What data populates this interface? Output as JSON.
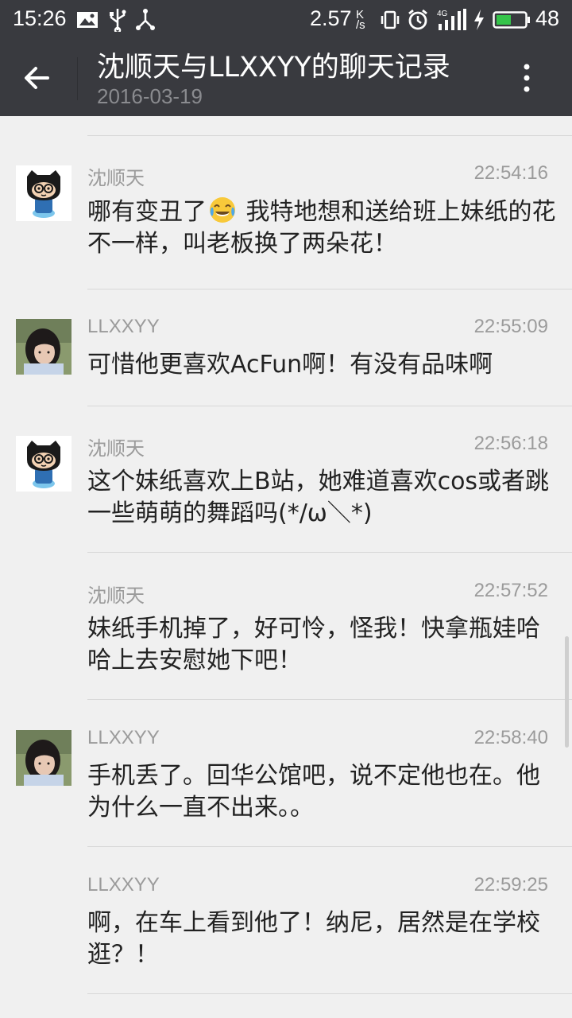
{
  "status_bar": {
    "time": "15:26",
    "net_speed": "2.57",
    "net_unit_top": "K",
    "net_unit_bottom": "/s",
    "battery": "48",
    "icons": [
      "image-icon",
      "usb-icon",
      "share-icon",
      "vibrate-icon",
      "alarm-icon",
      "signal-4g-icon",
      "charging-icon",
      "battery-icon"
    ]
  },
  "header": {
    "title": "沈顺天与LLXXYY的聊天记录",
    "date": "2016-03-19",
    "colors": {
      "bar": "#393a3f"
    }
  },
  "messages": [
    {
      "sender": "沈顺天",
      "time": "22:54:16",
      "avatar": "octocat-avatar",
      "text_before": "哪有变丑了",
      "emoji": "laughing-tears-emoji",
      "text_after": " 我特地想和送给班上妹纸的花不一样，叫老板换了两朵花！"
    },
    {
      "sender": "LLXXYY",
      "time": "22:55:09",
      "avatar": "photo-avatar",
      "text": "可惜他更喜欢AcFun啊！有没有品味啊"
    },
    {
      "sender": "沈顺天",
      "time": "22:56:18",
      "avatar": "octocat-avatar",
      "text": "这个妹纸喜欢上B站，她难道喜欢cos或者跳一些萌萌的舞蹈吗(*/ω＼*)"
    },
    {
      "sender": "沈顺天",
      "time": "22:57:52",
      "avatar": "none",
      "text": "妹纸手机掉了，好可怜，怪我！快拿瓶娃哈哈上去安慰她下吧！"
    },
    {
      "sender": "LLXXYY",
      "time": "22:58:40",
      "avatar": "photo-avatar",
      "text": "手机丢了。回华公馆吧，说不定他也在。他为什么一直不出来。。"
    },
    {
      "sender": "LLXXYY",
      "time": "22:59:25",
      "avatar": "none",
      "text": "啊，在车上看到他了！纳尼，居然是在学校逛？！"
    }
  ]
}
